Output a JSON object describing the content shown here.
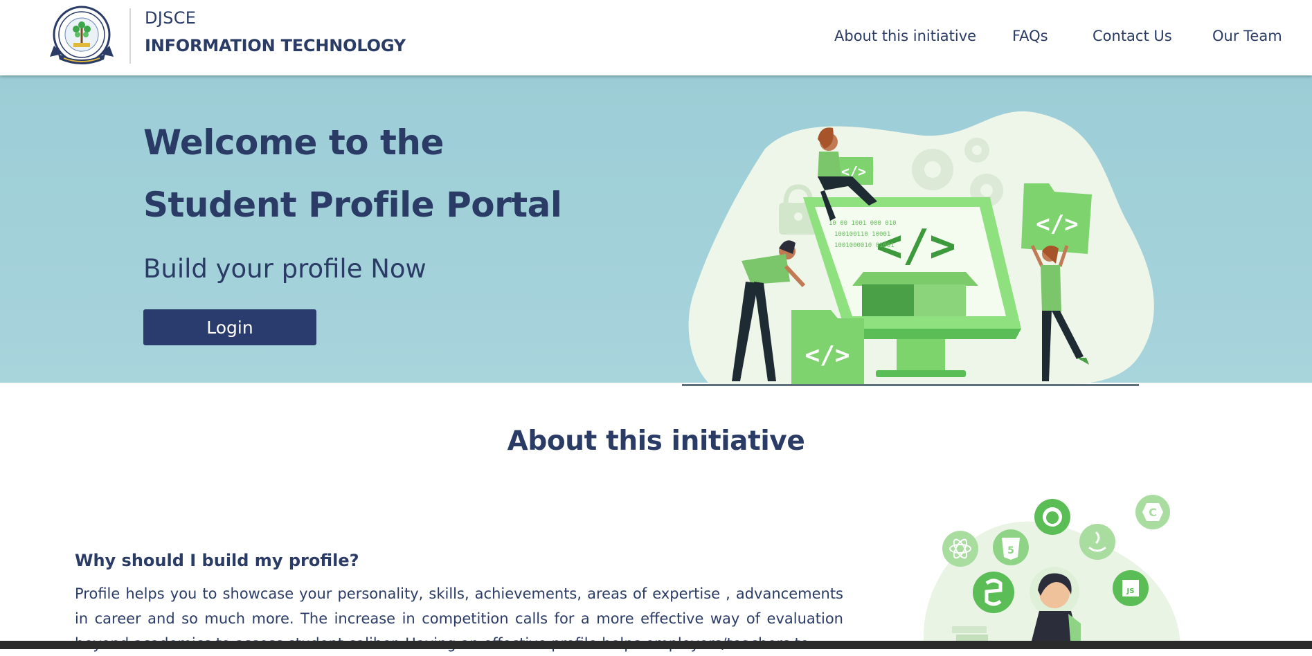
{
  "header": {
    "brand_top": "DJSCE",
    "brand_bottom": "INFORMATION TECHNOLOGY",
    "nav": [
      {
        "label": "About this initiative"
      },
      {
        "label": "FAQs"
      },
      {
        "label": "Contact Us"
      },
      {
        "label": "Our Team"
      }
    ]
  },
  "hero": {
    "title_line1": "Welcome to the",
    "title_line2": "Student Profile Portal",
    "subtitle": "Build your profile Now",
    "login_label": "Login"
  },
  "about": {
    "heading": "About this initiative",
    "why_heading": "Why should I build my profile?",
    "why_text": "Profile helps you to showcase your personality, skills, achievements, areas of expertise , advancements in career and so much more. The increase in competition calls for a more effective way of evaluation beyond academics to assess student caliber. Having an effective profile helps employers/teachers to"
  },
  "colors": {
    "primary": "#2a3b6e",
    "hero_bg": "#a2d0d8",
    "accent_green": "#7ed36f"
  }
}
